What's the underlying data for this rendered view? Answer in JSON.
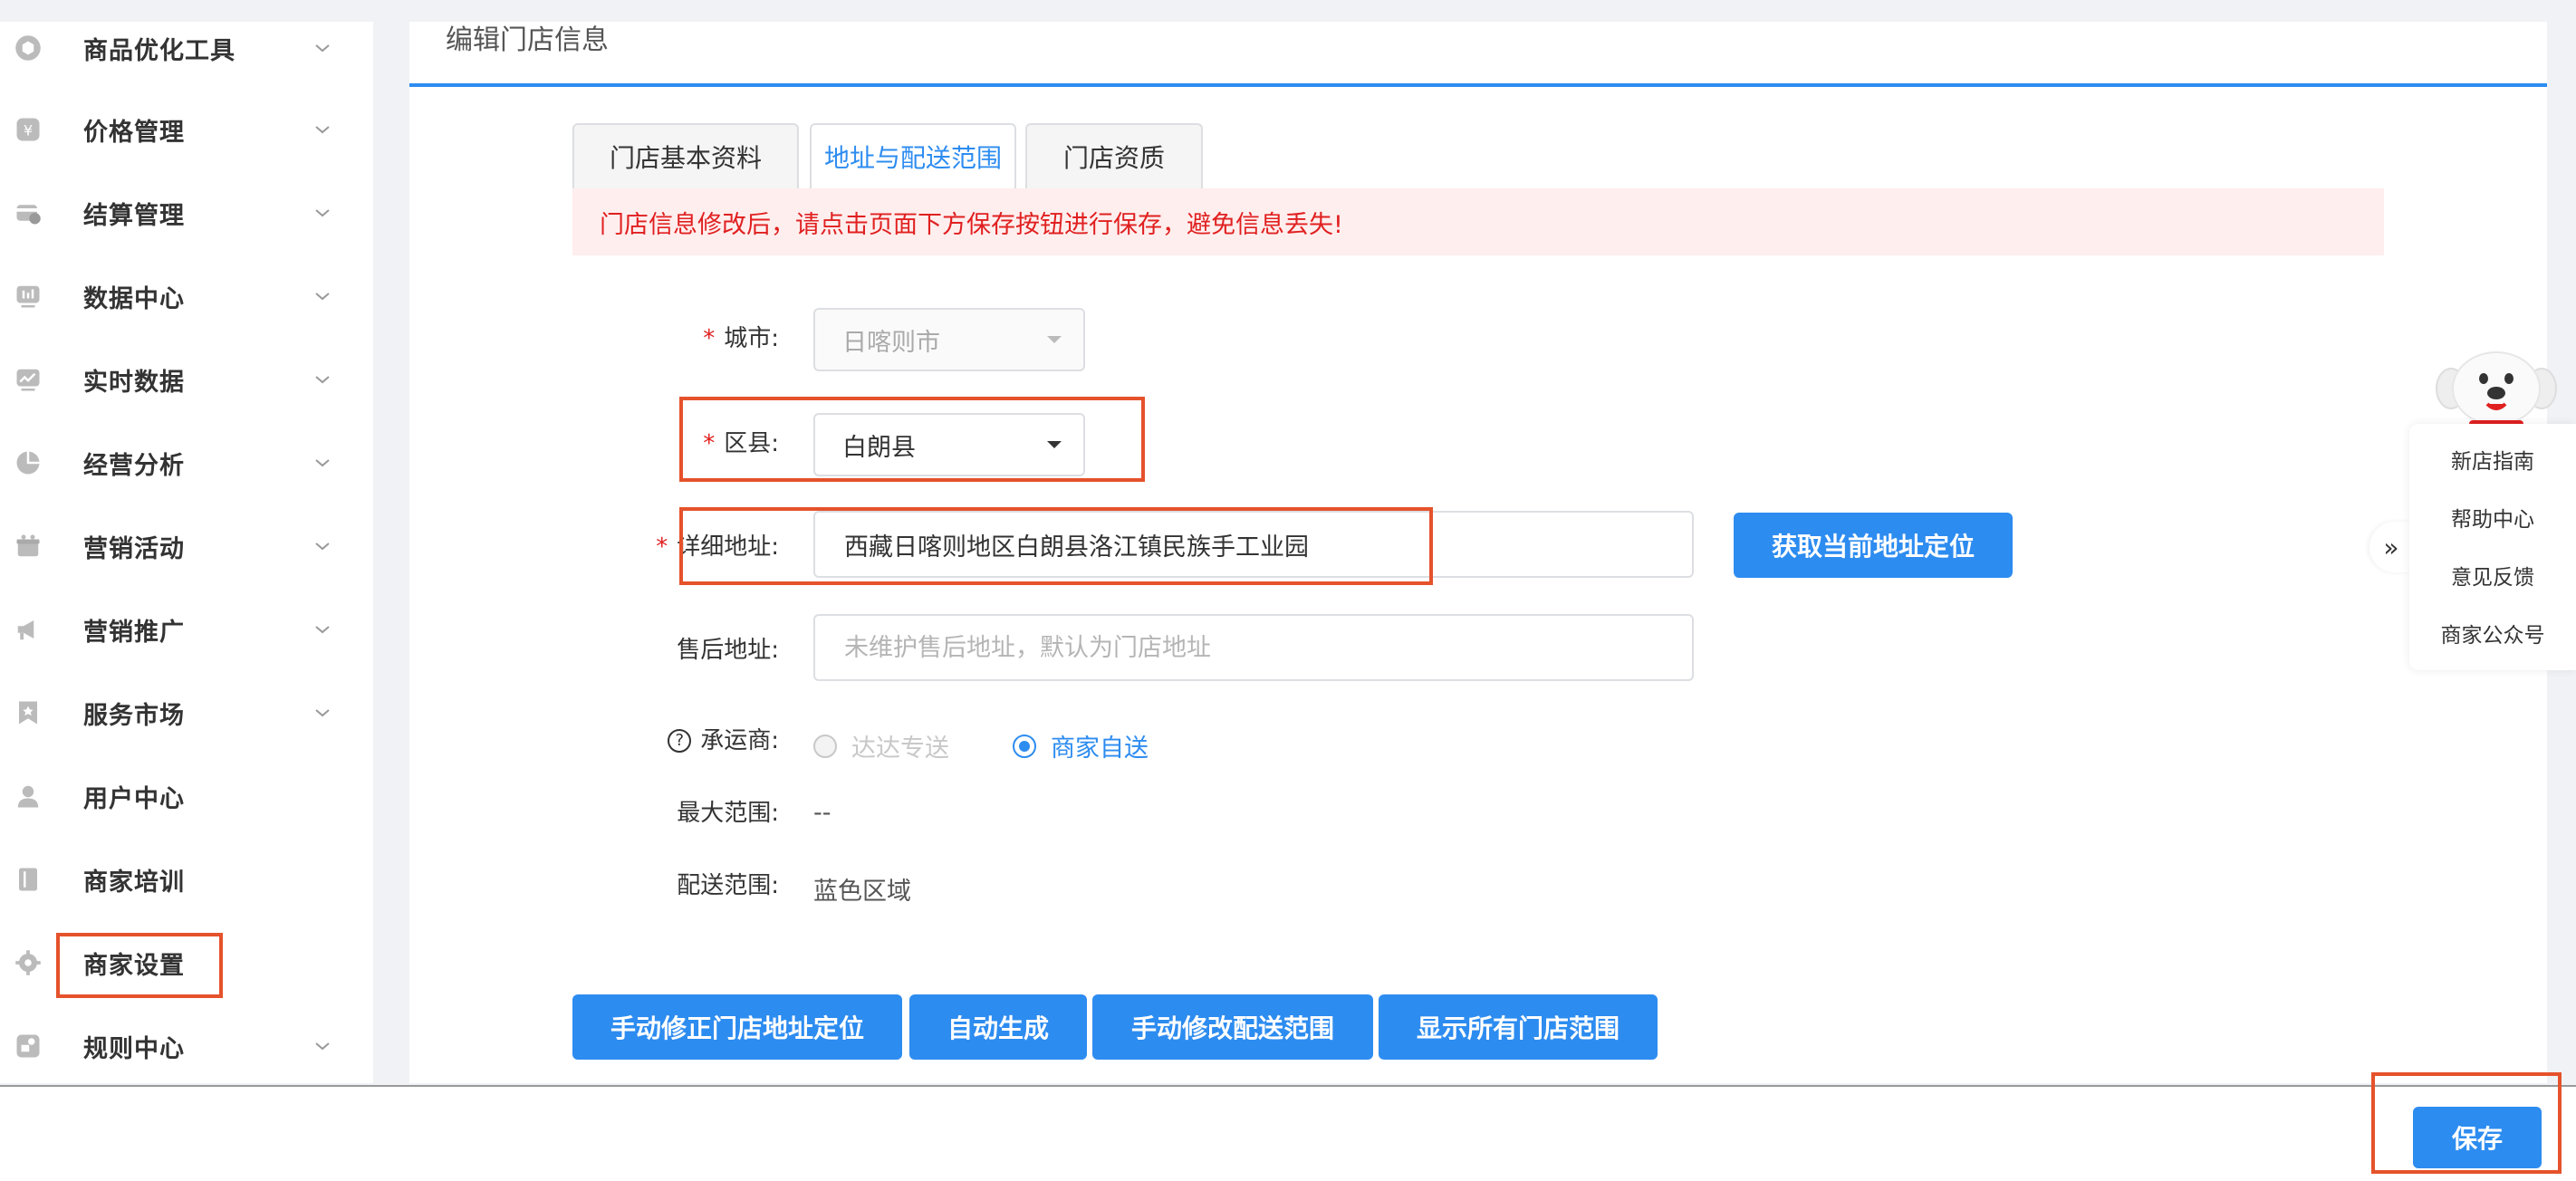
{
  "sidebar": {
    "items": [
      {
        "label": "商品优化工具",
        "icon": "cube-icon",
        "chevron": true
      },
      {
        "label": "价格管理",
        "icon": "yen-icon",
        "chevron": true
      },
      {
        "label": "结算管理",
        "icon": "settlement-icon",
        "chevron": true
      },
      {
        "label": "数据中心",
        "icon": "data-center-icon",
        "chevron": true
      },
      {
        "label": "实时数据",
        "icon": "realtime-chart-icon",
        "chevron": true
      },
      {
        "label": "经营分析",
        "icon": "pie-chart-icon",
        "chevron": true
      },
      {
        "label": "营销活动",
        "icon": "gift-icon",
        "chevron": true
      },
      {
        "label": "营销推广",
        "icon": "megaphone-icon",
        "chevron": true
      },
      {
        "label": "服务市场",
        "icon": "bookmark-star-icon",
        "chevron": true
      },
      {
        "label": "用户中心",
        "icon": "user-icon",
        "chevron": false
      },
      {
        "label": "商家培训",
        "icon": "book-icon",
        "chevron": false
      },
      {
        "label": "商家设置",
        "icon": "gear-icon",
        "chevron": false
      },
      {
        "label": "规则中心",
        "icon": "rules-icon",
        "chevron": true
      }
    ]
  },
  "main": {
    "title": "编辑门店信息",
    "tabs": [
      "门店基本资料",
      "地址与配送范围",
      "门店资质"
    ],
    "active_tab": 1,
    "alert": "门店信息修改后，请点击页面下方保存按钮进行保存，避免信息丢失!",
    "form": {
      "city_label": "城市:",
      "city_value": "日喀则市",
      "district_label": "区县:",
      "district_value": "白朗县",
      "address_label": "详细地址:",
      "address_value": "西藏日喀则地区白朗县洛江镇民族手工业园",
      "locate_button": "获取当前地址定位",
      "aftersale_label": "售后地址:",
      "aftersale_placeholder": "未维护售后地址，默认为门店地址",
      "carrier_label": "承运商:",
      "carrier_help": "?",
      "carrier_options": [
        "达达专送",
        "商家自送"
      ],
      "carrier_selected": "商家自送",
      "max_range_label": "最大范围:",
      "max_range_value": "--",
      "delivery_range_label": "配送范围:",
      "delivery_range_value": "蓝色区域",
      "required_mark": "*"
    },
    "action_buttons": [
      "手动修正门店地址定位",
      "自动生成",
      "手动修改配送范围",
      "显示所有门店范围"
    ]
  },
  "float_panel": {
    "collapse": "»",
    "items": [
      "新店指南",
      "帮助中心",
      "意见反馈",
      "商家公众号"
    ]
  },
  "footer": {
    "save": "保存"
  },
  "colors": {
    "primary": "#2d8cf0",
    "alert_bg": "#ffeeee",
    "alert_text": "#e02020",
    "highlight_box": "#e5522b"
  }
}
